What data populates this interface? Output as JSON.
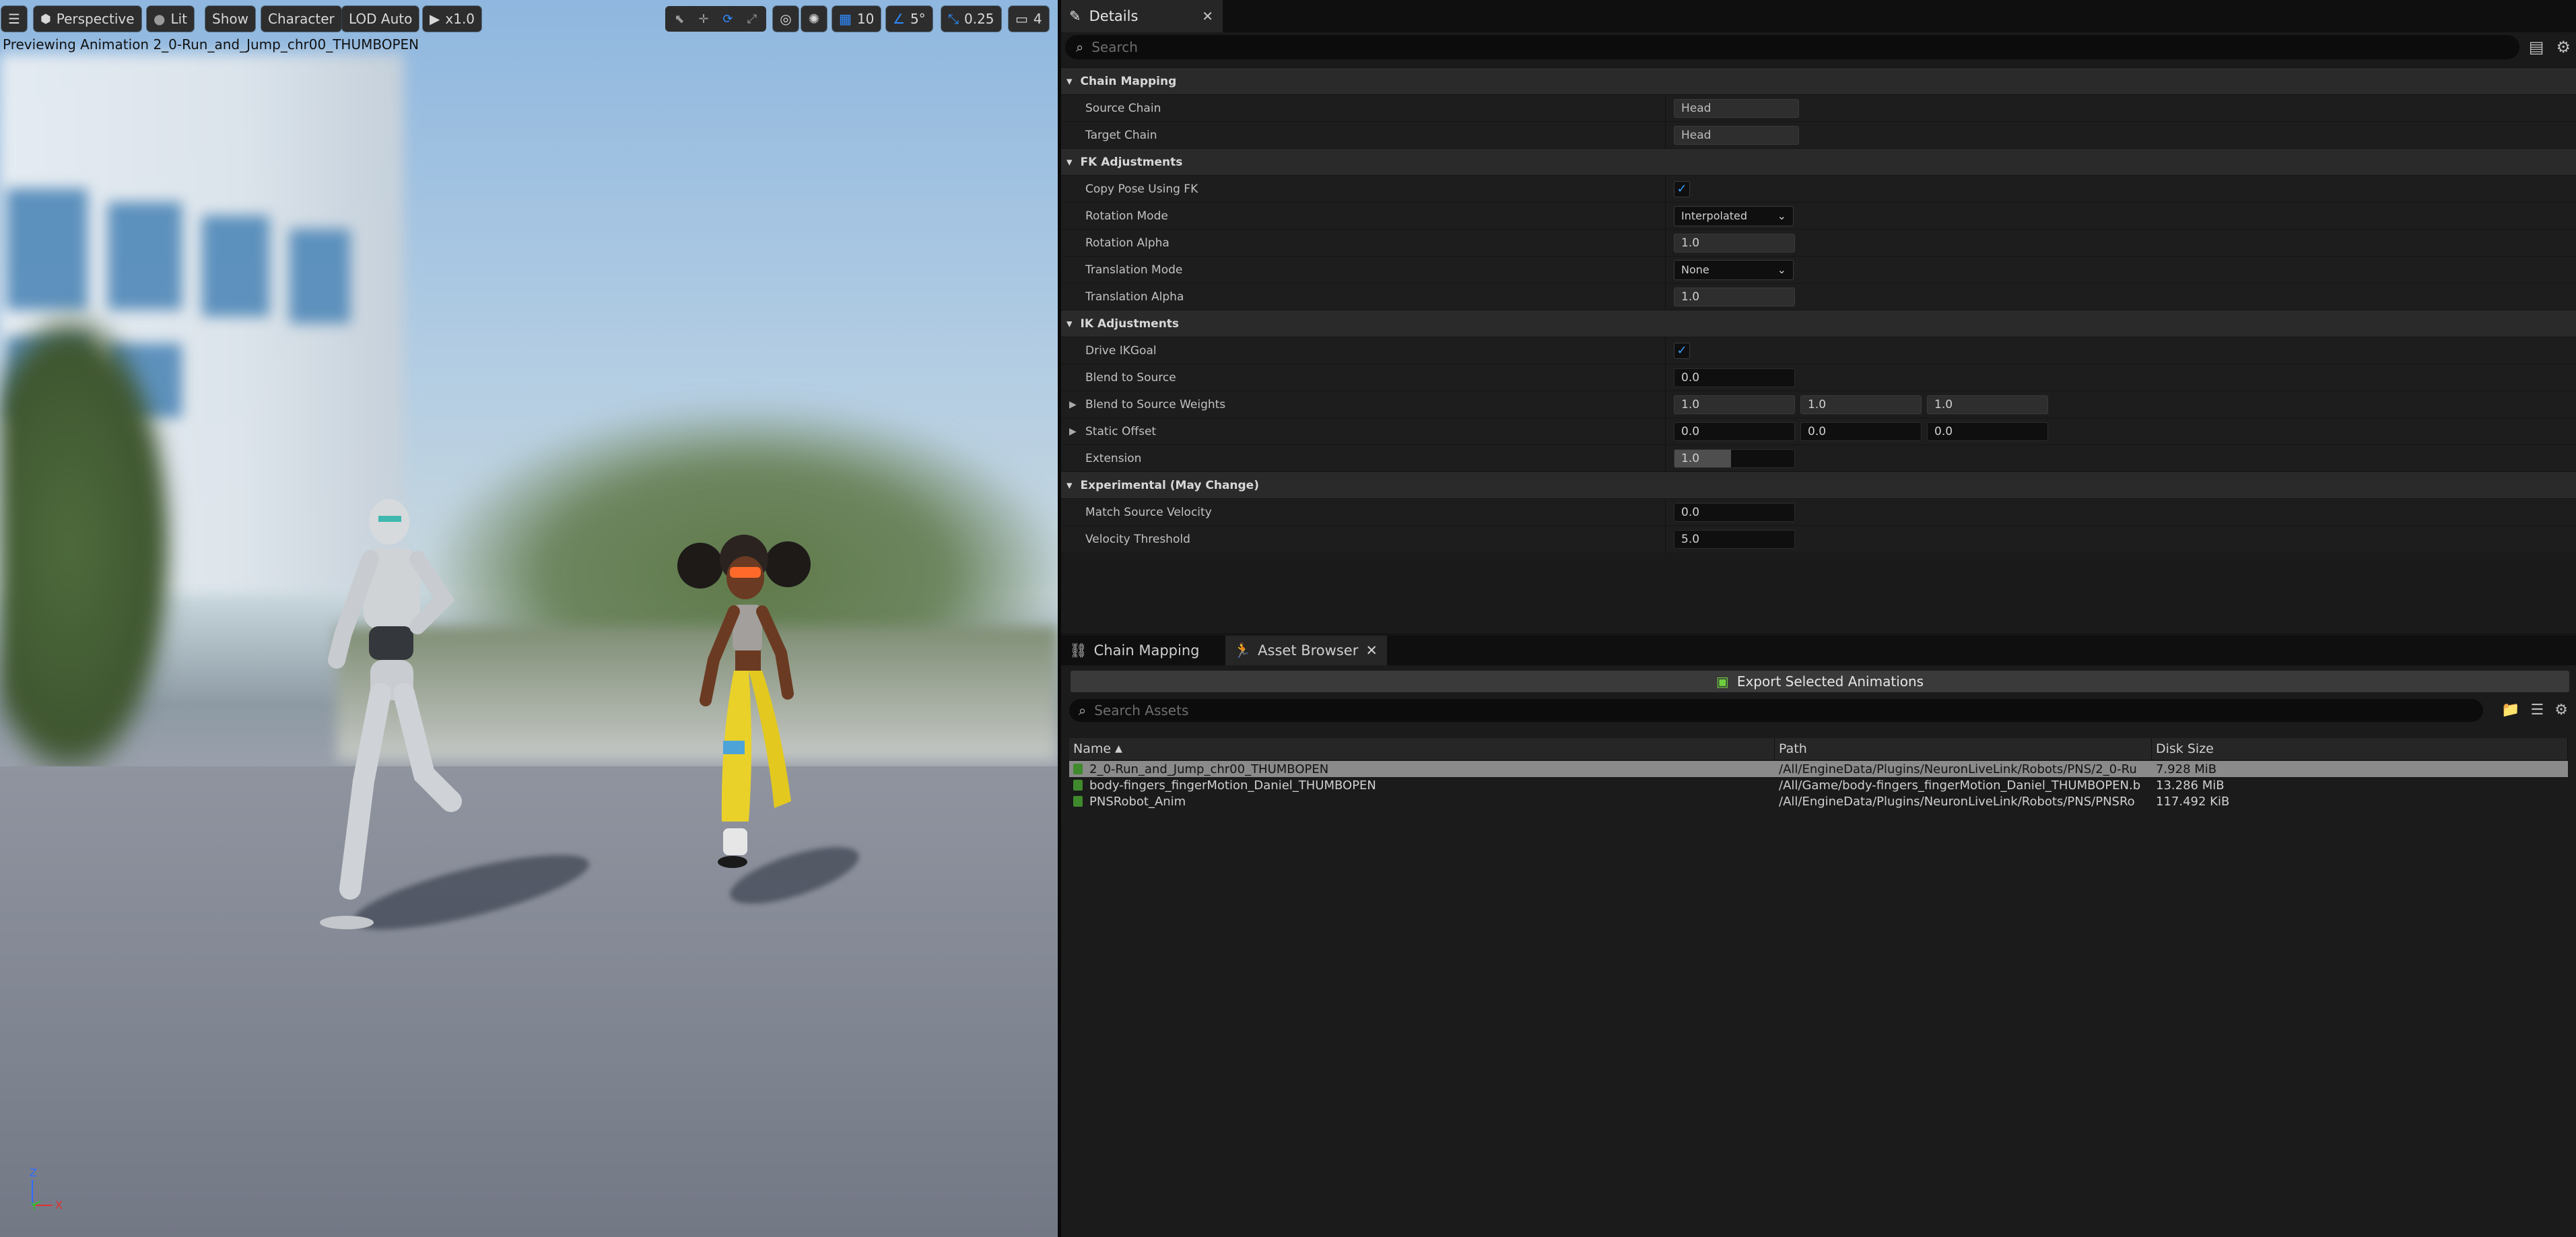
{
  "viewport": {
    "toolbar": {
      "perspective": "Perspective",
      "lit": "Lit",
      "show": "Show",
      "character": "Character",
      "lod": "LOD Auto",
      "play_speed": "x1.0",
      "grid_size": "10",
      "angle_snap": "5°",
      "scale_snap": "0.25",
      "camera_speed": "4"
    },
    "preview_label": "Previewing Animation 2_0-Run_and_Jump_chr00_THUMBOPEN",
    "axis": {
      "z": "Z",
      "y": "Y",
      "x": "X"
    }
  },
  "details": {
    "tab_title": "Details",
    "search_placeholder": "Search",
    "sections": {
      "chain_mapping": "Chain Mapping",
      "fk": "FK Adjustments",
      "ik": "IK Adjustments",
      "experimental": "Experimental (May Change)"
    },
    "props": {
      "source_chain": {
        "label": "Source Chain",
        "value": "Head"
      },
      "target_chain": {
        "label": "Target Chain",
        "value": "Head"
      },
      "copy_pose": {
        "label": "Copy Pose Using FK",
        "checked": true
      },
      "rotation_mode": {
        "label": "Rotation Mode",
        "value": "Interpolated"
      },
      "rotation_alpha": {
        "label": "Rotation Alpha",
        "value": "1.0"
      },
      "translation_mode": {
        "label": "Translation Mode",
        "value": "None"
      },
      "translation_alpha": {
        "label": "Translation Alpha",
        "value": "1.0"
      },
      "drive_ikgoal": {
        "label": "Drive IKGoal",
        "checked": true
      },
      "blend_to_source": {
        "label": "Blend to Source",
        "value": "0.0"
      },
      "blend_weights": {
        "label": "Blend to Source Weights",
        "x": "1.0",
        "y": "1.0",
        "z": "1.0"
      },
      "static_offset": {
        "label": "Static Offset",
        "x": "0.0",
        "y": "0.0",
        "z": "0.0"
      },
      "extension": {
        "label": "Extension",
        "value": "1.0"
      },
      "match_velocity": {
        "label": "Match Source Velocity",
        "value": "0.0"
      },
      "velocity_threshold": {
        "label": "Velocity Threshold",
        "value": "5.0"
      }
    }
  },
  "bottom": {
    "tabs": {
      "chain_mapping": "Chain Mapping",
      "asset_browser": "Asset Browser"
    },
    "export_label": "Export Selected Animations",
    "search_placeholder": "Search Assets",
    "columns": {
      "name": "Name",
      "path": "Path",
      "size": "Disk Size"
    },
    "assets": [
      {
        "name": "2_0-Run_and_Jump_chr00_THUMBOPEN",
        "path": "/All/EngineData/Plugins/NeuronLiveLink/Robots/PNS/2_0-Ru",
        "size": "7.928 MiB"
      },
      {
        "name": "body-fingers_fingerMotion_Daniel_THUMBOPEN",
        "path": "/All/Game/body-fingers_fingerMotion_Daniel_THUMBOPEN.b",
        "size": "13.286 MiB"
      },
      {
        "name": "PNSRobot_Anim",
        "path": "/All/EngineData/Plugins/NeuronLiveLink/Robots/PNS/PNSRo",
        "size": "117.492 KiB"
      }
    ]
  }
}
